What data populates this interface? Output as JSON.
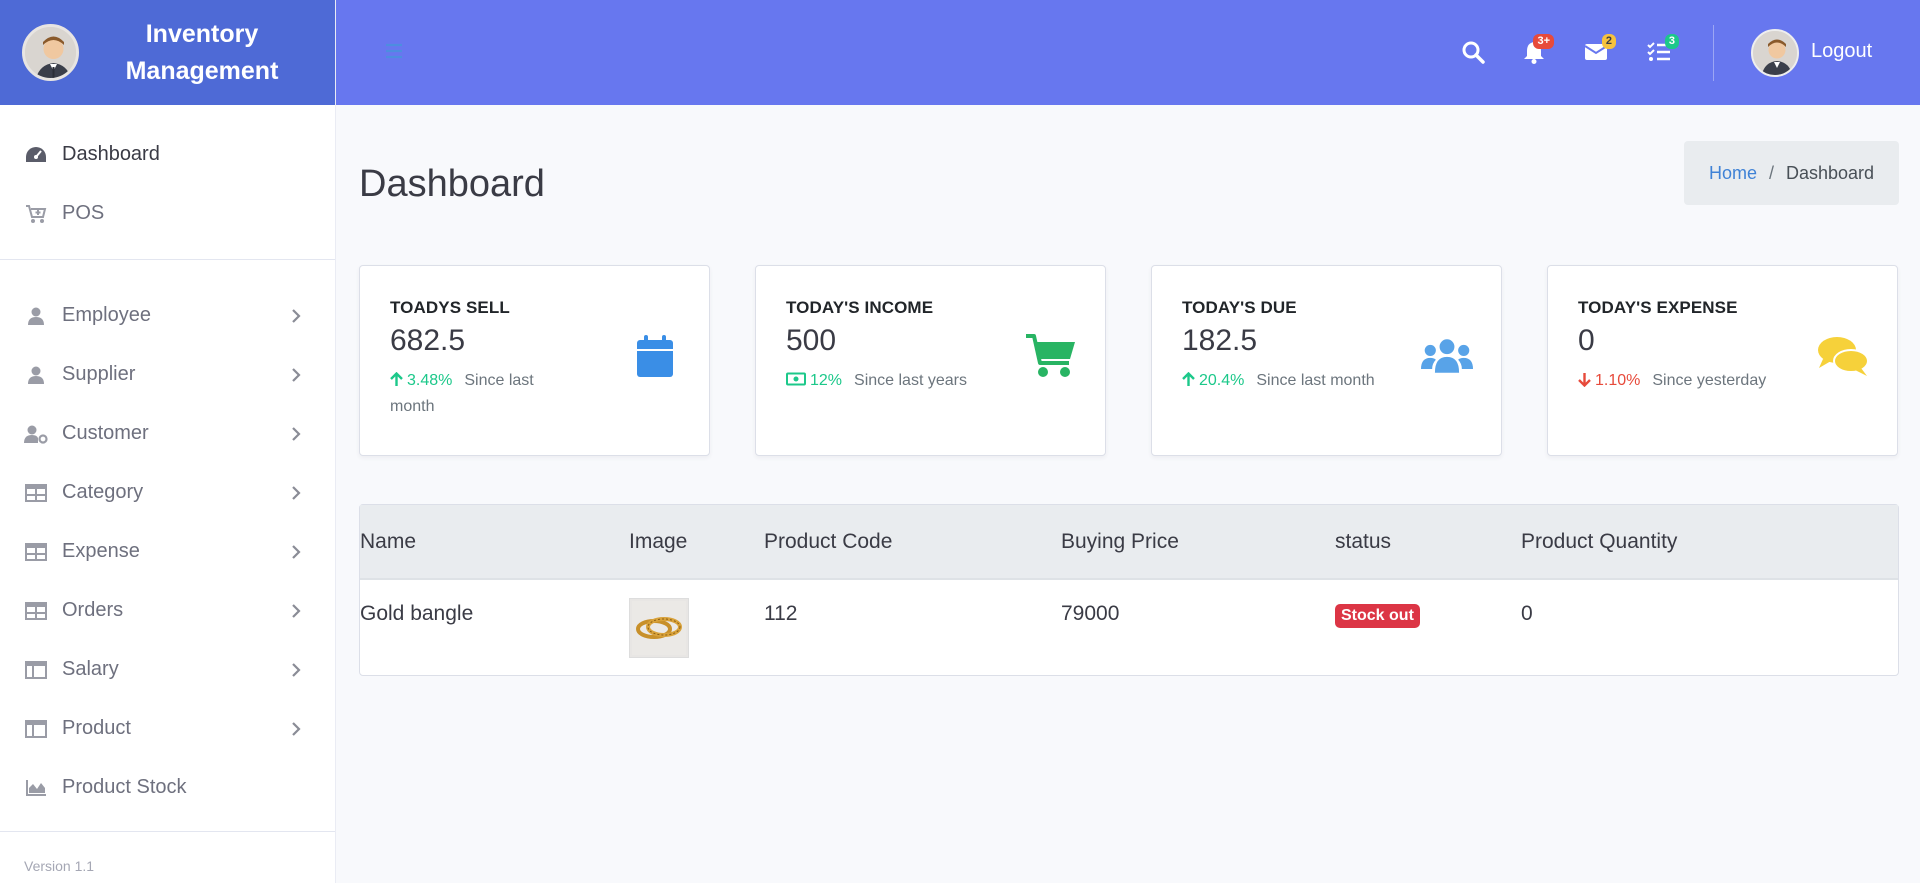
{
  "brand": {
    "title": "Inventory Management"
  },
  "sidebar": {
    "top_items": [
      {
        "label": "Dashboard",
        "icon": "tachometer-icon"
      },
      {
        "label": "POS",
        "icon": "cart-plus-icon"
      }
    ],
    "items": [
      {
        "label": "Employee",
        "icon": "user-icon"
      },
      {
        "label": "Supplier",
        "icon": "user-icon"
      },
      {
        "label": "Customer",
        "icon": "user-cog-icon"
      },
      {
        "label": "Category",
        "icon": "table-icon"
      },
      {
        "label": "Expense",
        "icon": "table-icon"
      },
      {
        "label": "Orders",
        "icon": "table-icon"
      },
      {
        "label": "Salary",
        "icon": "columns-icon"
      },
      {
        "label": "Product",
        "icon": "columns-icon"
      },
      {
        "label": "Product Stock",
        "icon": "chart-area-icon"
      }
    ],
    "version": "Version 1.1"
  },
  "topbar": {
    "notifications_badge": "3+",
    "messages_badge": "2",
    "tasks_badge": "3",
    "logout_label": "Logout"
  },
  "page": {
    "title": "Dashboard"
  },
  "breadcrumb": {
    "home": "Home",
    "separator": "/",
    "current": "Dashboard"
  },
  "cards": [
    {
      "label": "TOADYS SELL",
      "value": "682.5",
      "change": "3.48%",
      "trend": "up",
      "since": "Since last month",
      "icon": "calendar-icon",
      "color": "#3a8ee6"
    },
    {
      "label": "TODAY'S INCOME",
      "value": "500",
      "change": "12%",
      "trend": "money",
      "since": "Since last years",
      "icon": "shopping-cart-icon",
      "color": "#28b463"
    },
    {
      "label": "TODAY'S DUE",
      "value": "182.5",
      "change": "20.4%",
      "trend": "up",
      "since": "Since last month",
      "icon": "users-icon",
      "color": "#58a3e8"
    },
    {
      "label": "TODAY'S EXPENSE",
      "value": "0",
      "change": "1.10%",
      "trend": "down",
      "since": "Since yesterday",
      "icon": "comments-icon",
      "color": "#f6d13a"
    }
  ],
  "table": {
    "headers": [
      "Name",
      "Image",
      "Product Code",
      "Buying Price",
      "status",
      "Product Quantity"
    ],
    "rows": [
      {
        "name": "Gold bangle",
        "image": "gold-bangle-thumbnail",
        "code": "112",
        "price": "79000",
        "status": "Stock out",
        "quantity": "0"
      }
    ]
  },
  "colors": {
    "topbar": "#6777ef",
    "brand": "#4e6ad6",
    "positive": "#1cc88a",
    "negative": "#e74a3b",
    "danger_badge": "#dc3545"
  }
}
